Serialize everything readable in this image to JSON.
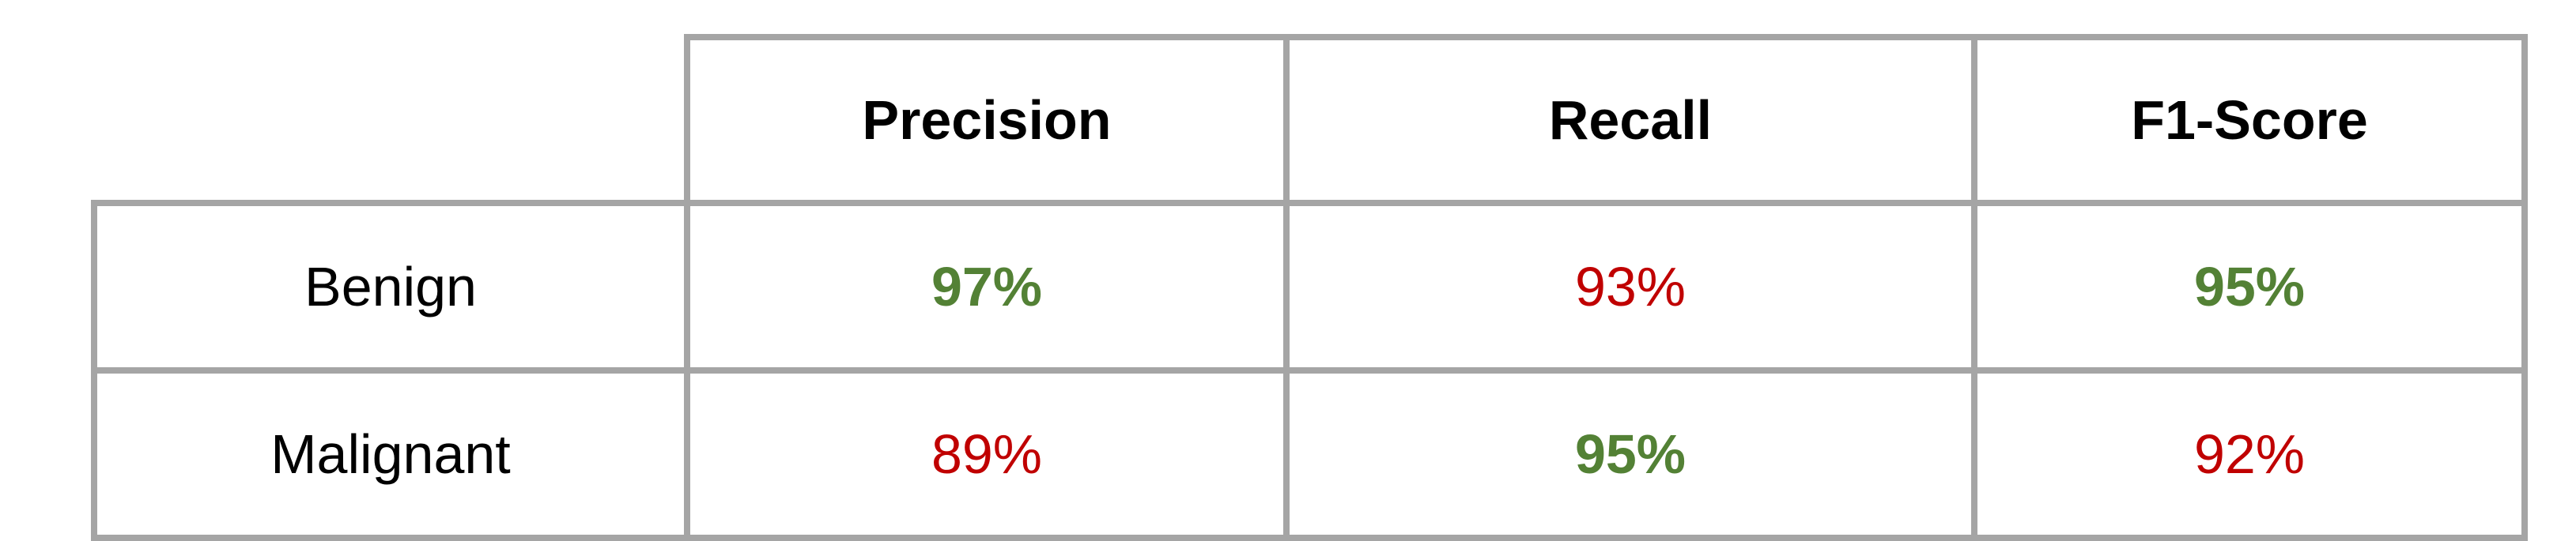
{
  "table": {
    "headers": [
      "",
      "Precision",
      "Recall",
      "F1-Score"
    ],
    "rows": [
      {
        "label": "Benign",
        "cells": [
          {
            "value": "97%",
            "status": "good"
          },
          {
            "value": "93%",
            "status": "bad"
          },
          {
            "value": "95%",
            "status": "good"
          }
        ]
      },
      {
        "label": "Malignant",
        "cells": [
          {
            "value": "89%",
            "status": "bad"
          },
          {
            "value": "95%",
            "status": "good"
          },
          {
            "value": "92%",
            "status": "bad"
          }
        ]
      }
    ]
  },
  "colors": {
    "good": "#538135",
    "bad": "#c00000",
    "border": "#a5a5a5"
  }
}
